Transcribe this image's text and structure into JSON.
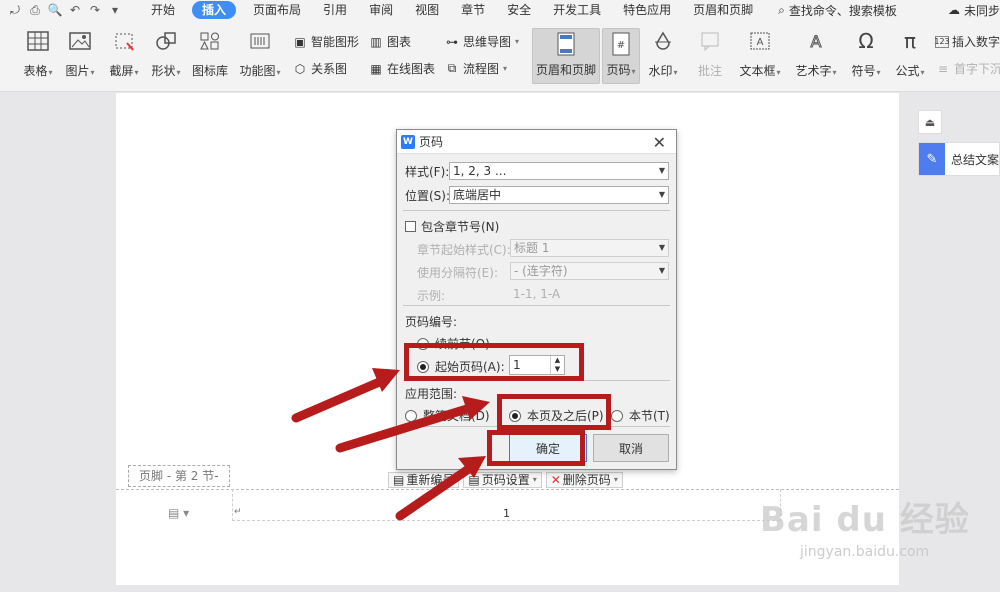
{
  "menubar": {
    "tabs": [
      "开始",
      "插入",
      "页面布局",
      "引用",
      "审阅",
      "视图",
      "章节",
      "安全",
      "开发工具",
      "特色应用",
      "页眉和页脚"
    ],
    "active_tab": "插入",
    "search": "查找命令、搜索模板",
    "sync": "未同步"
  },
  "ribbon": {
    "table": "表格",
    "picture": "图片",
    "screenshot": "截屏",
    "shape": "形状",
    "icon_lib": "图标库",
    "func_chart": "功能图",
    "smart_shape": "智能图形",
    "chart": "图表",
    "mindmap": "思维导图",
    "relation": "关系图",
    "online_chart": "在线图表",
    "flowchart": "流程图",
    "header_footer": "页眉和页脚",
    "page_number": "页码",
    "watermark": "水印",
    "comment": "批注",
    "textbox": "文本框",
    "wordart": "艺术字",
    "symbol": "符号",
    "formula": "公式",
    "insert_number": "插入数字",
    "drop_cap": "首字下沉"
  },
  "side": {
    "summary": "总结文案"
  },
  "dialog": {
    "title": "页码",
    "style_label": "样式(F):",
    "style_value": "1, 2, 3 ...",
    "position_label": "位置(S):",
    "position_value": "底端居中",
    "include_chapter": "包含章节号(N)",
    "chapter_start_label": "章节起始样式(C):",
    "chapter_start_value": "标题 1",
    "separator_label": "使用分隔符(E):",
    "separator_value": "-    (连字符)",
    "example_label": "示例:",
    "example_value": "1-1, 1-A",
    "numbering_title": "页码编号:",
    "continue_prev": "续前节(O)",
    "start_page": "起始页码(A):",
    "start_value": "1",
    "scope_title": "应用范围:",
    "whole_doc": "整篇文档(D)",
    "this_and_after": "本页及之后(P)",
    "this_section": "本节(T)",
    "ok": "确定",
    "cancel": "取消"
  },
  "footer": {
    "tag": "页脚 - 第 2 节-",
    "renumber": "重新编号",
    "page_settings": "页码设置",
    "delete_page_number": "删除页码",
    "page_number": "1"
  },
  "watermark": {
    "text": "Bai du 经验",
    "url": "jingyan.baidu.com"
  },
  "colors": {
    "accent": "#3f8ef5",
    "annotation": "#b71c1c"
  }
}
